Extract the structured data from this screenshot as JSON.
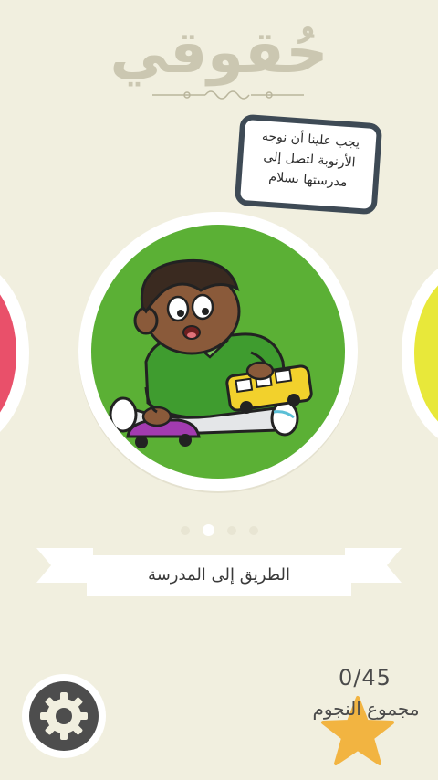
{
  "header": {
    "app_title": "حُقوقي"
  },
  "speech_bubble": {
    "text": "يجب علينا أن نوجه الأرنوبة لتصل إلى مدرستها بسلام"
  },
  "carousel": {
    "dots": [
      {
        "state": "inactive"
      },
      {
        "state": "active"
      },
      {
        "state": "inactive"
      },
      {
        "state": "inactive"
      }
    ],
    "current_index": 2,
    "current_title": "الطريق إلى المدرسة",
    "left_card_color": "#e9506a",
    "center_card_color": "#5bb035",
    "right_card_color": "#e8e83a"
  },
  "footer": {
    "settings_icon": "gear-icon",
    "stars": {
      "count": "0/45",
      "label": "مجموع النجوم",
      "icon": "star-icon",
      "color": "#f2b441"
    }
  }
}
